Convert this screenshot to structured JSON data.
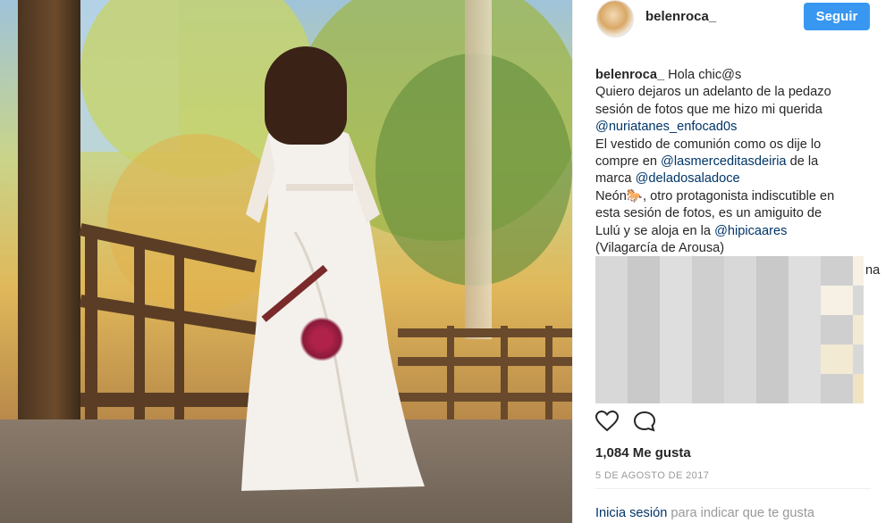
{
  "post": {
    "username": "belenroca_",
    "follow_label": "Seguir",
    "caption": {
      "author": "belenroca_",
      "lines": [
        {
          "text": "Hola chic@s",
          "inline_after_author": true
        },
        {
          "text": "Quiero dejaros un adelanto de la pedazo"
        },
        {
          "text": "sesión de fotos que me hizo mi querida"
        },
        {
          "mention": "@nuriatanes_enfocad0s"
        },
        {
          "text": "El vestido de comunión como os dije lo"
        },
        {
          "text": "compre en ",
          "mention": "@lasmerceditasdeiria",
          "after": " de la"
        },
        {
          "text": "marca ",
          "mention": "@deladosaladoce"
        },
        {
          "text": "Neón🐎, otro protagonista indiscutible en"
        },
        {
          "text": "esta sesión de fotos, es un amiguito de"
        },
        {
          "text": "Lulú y se aloja en la ",
          "mention": "@hipicaares"
        },
        {
          "text": "(Vilagarcía de Arousa)"
        }
      ],
      "partial_visible_fragment": "na"
    },
    "likes_text": "1,084 Me gusta",
    "date_text": "5 DE AGOSTO DE 2017",
    "login_prompt": {
      "link": "Inicia sesión",
      "rest": " para indicar que te gusta"
    }
  },
  "icons": {
    "like": "heart-icon",
    "comment": "comment-icon"
  },
  "colors": {
    "follow_button": "#3897f0",
    "mention": "#003569",
    "muted_text": "#999999",
    "text": "#262626"
  }
}
